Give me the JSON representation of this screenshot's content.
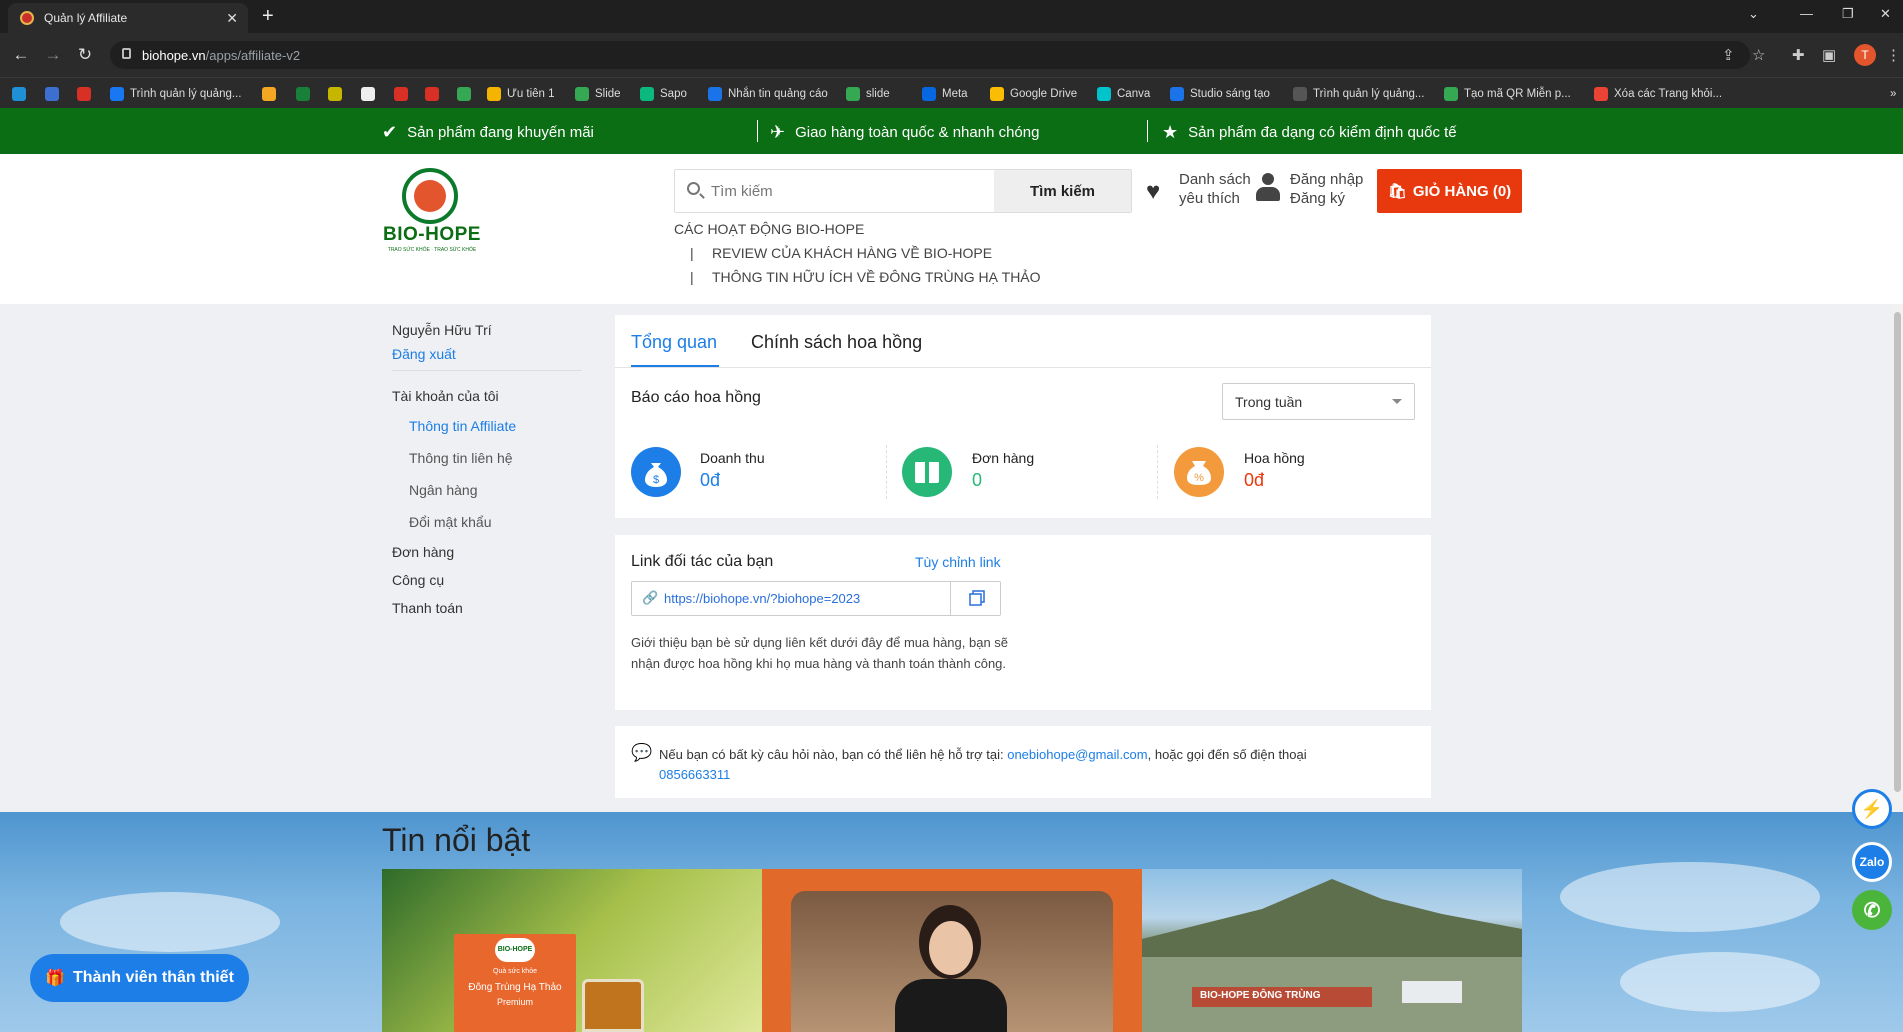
{
  "browser": {
    "tab_title": "Quản lý Affiliate",
    "url_host": "biohope.vn",
    "url_path": "/apps/affiliate-v2",
    "profile_initial": "T",
    "bookmarks": [
      {
        "label": "",
        "color": "#1f8fd6"
      },
      {
        "label": "",
        "color": "#3d6fd1"
      },
      {
        "label": "",
        "color": "#d93025"
      },
      {
        "label": "Trình quản lý quảng...",
        "color": "#1877f2"
      },
      {
        "label": "",
        "color": "#f5a623"
      },
      {
        "label": "",
        "color": "#188038"
      },
      {
        "label": "",
        "color": "#c7b600"
      },
      {
        "label": "",
        "color": "#eeeeee"
      },
      {
        "label": "",
        "color": "#d93025"
      },
      {
        "label": "",
        "color": "#d93025"
      },
      {
        "label": "",
        "color": "#34a853"
      },
      {
        "label": "Ưu tiên 1",
        "color": "#f4b400"
      },
      {
        "label": "Slide",
        "color": "#34a853"
      },
      {
        "label": "Sapo",
        "color": "#0bb87e"
      },
      {
        "label": "Nhắn tin quảng cáo",
        "color": "#1a73e8"
      },
      {
        "label": "slide",
        "color": "#34a853"
      },
      {
        "label": "Meta",
        "color": "#0668e1"
      },
      {
        "label": "Google Drive",
        "color": "#fbbc04"
      },
      {
        "label": "Canva",
        "color": "#00c4cc"
      },
      {
        "label": "Studio sáng tạo",
        "color": "#1a73e8"
      },
      {
        "label": "Trình quản lý quảng...",
        "color": "#555555"
      },
      {
        "label": "Tạo mã QR Miễn p...",
        "color": "#34a853"
      },
      {
        "label": "Xóa các Trang khỏi...",
        "color": "#ea4335"
      }
    ]
  },
  "promo": {
    "item1": "Sản phẩm đang khuyến mãi",
    "item2": "Giao hàng toàn quốc & nhanh chóng",
    "item3": "Sản phẩm đa dạng có kiểm định quốc tế"
  },
  "header": {
    "logo_text": "BIO-HOPE",
    "logo_tagline": "TRAO SỨC KHỎE · TRAO SỨC KHỎE",
    "search_placeholder": "Tìm kiếm",
    "search_button": "Tìm kiếm",
    "wishlist_line1": "Danh sách",
    "wishlist_line2": "yêu thích",
    "login_line1": "Đăng nhập",
    "login_line2": "Đăng ký",
    "cart_label": "GIỎ HÀNG (0)",
    "menu": [
      "CÁC HOẠT ĐỘNG BIO-HOPE",
      "REVIEW CỦA KHÁCH HÀNG VỀ BIO-HOPE",
      "THÔNG TIN HỮU ÍCH VỀ ĐÔNG TRÙNG HẠ THẢO"
    ],
    "menu_separator": "|"
  },
  "sidebar": {
    "user_name": "Nguyễn Hữu Trí",
    "logout": "Đăng xuất",
    "account": "Tài khoản của tôi",
    "account_items": [
      "Thông tin Affiliate",
      "Thông tin liên hệ",
      "Ngân hàng",
      "Đổi mật khẩu"
    ],
    "orders": "Đơn hàng",
    "tools": "Công cụ",
    "payment": "Thanh toán"
  },
  "main": {
    "tabs": [
      "Tổng quan",
      "Chính sách hoa hồng"
    ],
    "report_title": "Báo cáo hoa hồng",
    "period_selected": "Trong tuần",
    "stats": [
      {
        "label": "Doanh thu",
        "value": "0đ",
        "color": "#1c7ee6"
      },
      {
        "label": "Đơn hàng",
        "value": "0",
        "color": "#27b877"
      },
      {
        "label": "Hoa hồng",
        "value": "0đ",
        "color": "#e8390e"
      }
    ],
    "link_title": "Link đối tác của bạn",
    "customize_link": "Tùy chỉnh link",
    "affiliate_url": "https://biohope.vn/?biohope=2023",
    "intro_text": "Giới thiệu bạn bè sử dụng liên kết dưới đây để mua hàng, bạn sẽ nhận được hoa hồng khi họ mua hàng và thanh toán thành công.",
    "support_text_before": "Nếu bạn có bất kỳ câu hỏi nào, bạn có thể liên hệ hỗ trợ tại:",
    "support_email": "onebiohope@gmail.com",
    "support_text_after": ", hoặc gọi đến số điện thoại",
    "support_phone": "0856663311"
  },
  "news": {
    "title": "Tin nổi bật",
    "product_logo": "BIO-HOPE",
    "product_line1": "Quà sức khỏe",
    "product_line2": "Đông Trùng Hạ Thảo",
    "product_line3": "Premium",
    "banner_text": "BIO-HOPE ĐÔNG TRÙNG"
  },
  "floating": {
    "member_button": "Thành viên thân thiết",
    "zalo": "Zalo"
  }
}
